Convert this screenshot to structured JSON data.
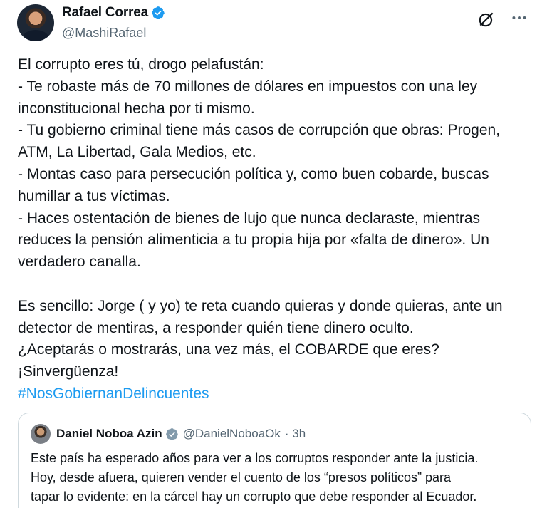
{
  "author": {
    "display_name": "Rafael Correa",
    "handle": "@MashiRafael"
  },
  "tweet": {
    "lines": [
      "El corrupto eres tú, drogo pelafustán:",
      "- Te robaste más de 70 millones de dólares en impuestos con una ley",
      "inconstitucional hecha por ti mismo.",
      "- Tu gobierno criminal tiene más casos de corrupción que obras: Progen,",
      "ATM, La Libertad, Gala Medios, etc.",
      "- Montas caso para persecución política y, como buen cobarde, buscas",
      "humillar a tus víctimas.",
      "- Haces ostentación de bienes de lujo que nunca declaraste, mientras",
      "reduces la pensión alimenticia a tu propia hija por «falta de dinero». Un",
      "verdadero canalla.",
      "",
      "Es sencillo: Jorge ( y yo) te reta cuando quieras y donde quieras, ante un",
      "detector de mentiras, a responder quién tiene dinero oculto.",
      "¿Aceptarás o mostrarás, una vez más, el COBARDE que eres?",
      "¡Sinvergüenza!"
    ],
    "hashtag": "#NosGobiernanDelincuentes"
  },
  "quoted": {
    "display_name": "Daniel Noboa Azin",
    "handle": "@DanielNoboaOk",
    "time": "· 3h",
    "lines": [
      "Este país ha esperado años para ver a los corruptos responder ante la justicia.",
      "Hoy, desde afuera, quieren vender el cuento de los “presos políticos” para",
      "tapar lo evidente: en la cárcel hay un corrupto que debe responder al Ecuador."
    ]
  },
  "colors": {
    "text": "#0f1419",
    "secondary": "#536471",
    "link": "#1d9bf0",
    "border": "#cfd9de"
  },
  "icons": [
    "verified-badge-icon",
    "grok-icon",
    "more-options-icon"
  ]
}
